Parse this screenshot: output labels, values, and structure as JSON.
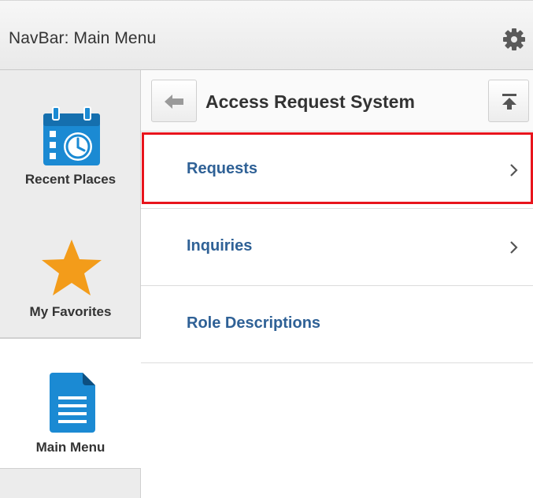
{
  "header": {
    "title": "NavBar: Main Menu",
    "settings_icon": "gear-icon"
  },
  "sidebar": {
    "items": [
      {
        "label": "Recent Places",
        "icon": "calendar-clock-icon",
        "active": false
      },
      {
        "label": "My Favorites",
        "icon": "star-icon",
        "active": false
      },
      {
        "label": "Main Menu",
        "icon": "document-icon",
        "active": true
      }
    ]
  },
  "content": {
    "title": "Access Request System",
    "back_icon": "arrow-left-icon",
    "top_icon": "arrow-up-to-top-icon",
    "items": [
      {
        "label": "Requests",
        "has_children": true,
        "highlighted": true
      },
      {
        "label": "Inquiries",
        "has_children": true,
        "highlighted": false
      },
      {
        "label": "Role Descriptions",
        "has_children": false,
        "highlighted": false
      }
    ]
  },
  "colors": {
    "link": "#2f6196",
    "highlight": "#e8141c",
    "icon_blue": "#1b8ad3",
    "star": "#f39c1a"
  }
}
